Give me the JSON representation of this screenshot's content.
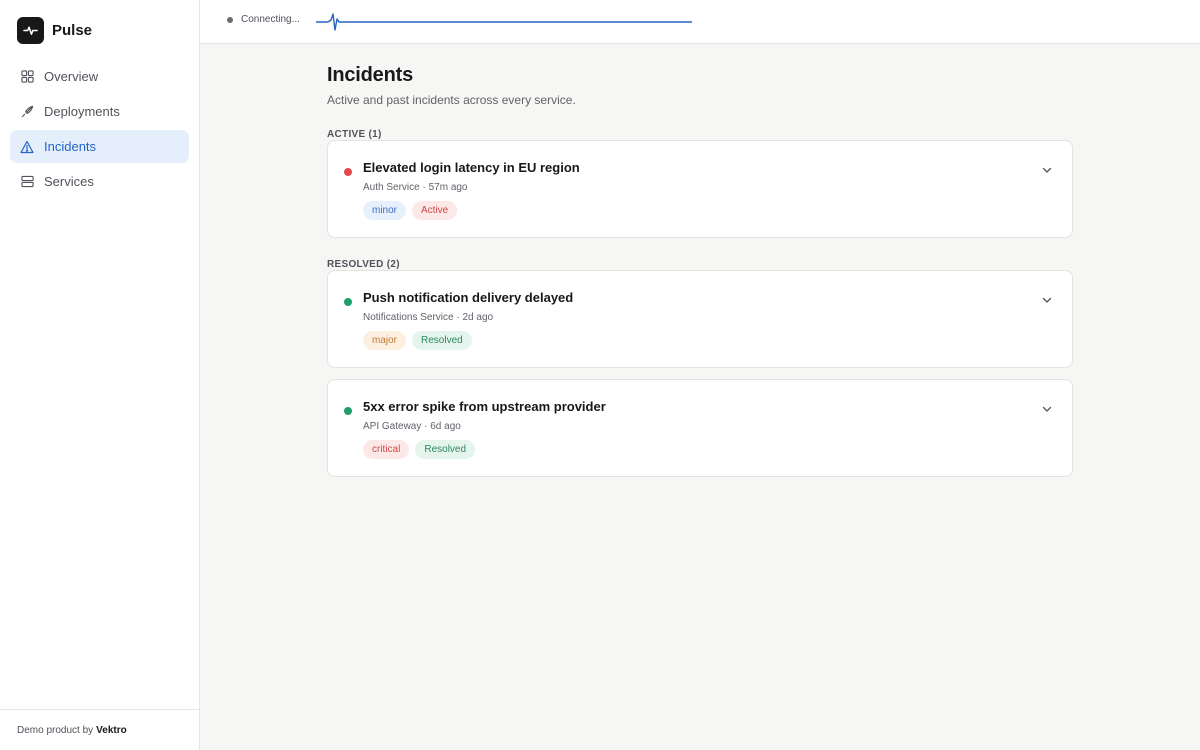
{
  "app": {
    "name": "Pulse"
  },
  "sidebar": {
    "items": [
      {
        "label": "Overview",
        "icon": "grid-icon",
        "active": false,
        "name": "sidebar-item-overview"
      },
      {
        "label": "Deployments",
        "icon": "rocket-icon",
        "active": false,
        "name": "sidebar-item-deployments"
      },
      {
        "label": "Incidents",
        "icon": "warning-triangle-icon",
        "active": true,
        "name": "sidebar-item-incidents"
      },
      {
        "label": "Services",
        "icon": "server-icon",
        "active": false,
        "name": "sidebar-item-services"
      }
    ],
    "footer": {
      "prefix": "Demo product by",
      "brand": "Vektro"
    }
  },
  "topbar": {
    "status": "Connecting..."
  },
  "page": {
    "title": "Incidents",
    "subtitle": "Active and past incidents across every service."
  },
  "sections": {
    "active": {
      "label": "ACTIVE (1)",
      "incidents": [
        {
          "title": "Elevated login latency in EU region",
          "meta": "Auth Service · 57m ago",
          "dot_color": "#e5484d",
          "severity": "minor",
          "severity_bg": "#e7f0fd",
          "severity_fg": "#3b6fc4",
          "status": "Active",
          "status_bg": "#fde8e8",
          "status_fg": "#d04848"
        }
      ]
    },
    "resolved": {
      "label": "RESOLVED (2)",
      "incidents": [
        {
          "title": "Push notification delivery delayed",
          "meta": "Notifications Service · 2d ago",
          "dot_color": "#1f9d6b",
          "severity": "major",
          "severity_bg": "#fdf0e1",
          "severity_fg": "#c27a2c",
          "status": "Resolved",
          "status_bg": "#e6f4ee",
          "status_fg": "#2b8a62"
        },
        {
          "title": "5xx error spike from upstream provider",
          "meta": "API Gateway · 6d ago",
          "dot_color": "#1f9d6b",
          "severity": "critical",
          "severity_bg": "#fde8e8",
          "severity_fg": "#d04848",
          "status": "Resolved",
          "status_bg": "#e6f4ee",
          "status_fg": "#2b8a62"
        }
      ]
    }
  },
  "colors": {
    "accent": "#2563c4",
    "pulse": "#2563c4"
  }
}
